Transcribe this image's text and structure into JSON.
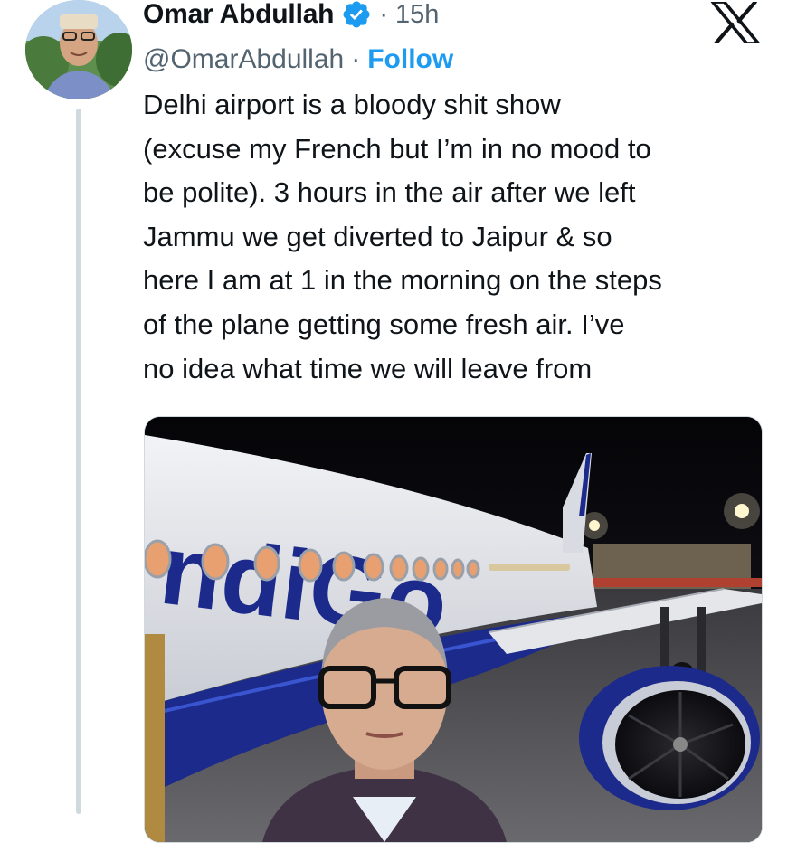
{
  "tweet": {
    "author": {
      "display_name": "Omar Abdullah",
      "handle": "@OmarAbdullah",
      "verified_icon": "verified-badge-icon",
      "avatar": "profile-photo"
    },
    "separator": "·",
    "time": "15h",
    "follow_label": "Follow",
    "text_lines": [
      "Delhi airport is a bloody shit show",
      "(excuse my French but I’m in no mood to",
      "be polite). 3 hours in the air after we left",
      "Jammu we get diverted to Jaipur & so",
      "here I am at 1 in the morning on the steps",
      "of the plane getting some fresh air. I’ve",
      "no idea what time we will leave from"
    ],
    "media": {
      "airline_logo_text": "ndiGo",
      "type": "photo"
    }
  },
  "platform": {
    "logo": "x-logo-icon"
  },
  "colors": {
    "text": "#0f1419",
    "secondary_text": "#536471",
    "accent": "#1d9bf0",
    "thread_line": "#cfd9de",
    "indigo_blue": "#1c2a8c"
  }
}
